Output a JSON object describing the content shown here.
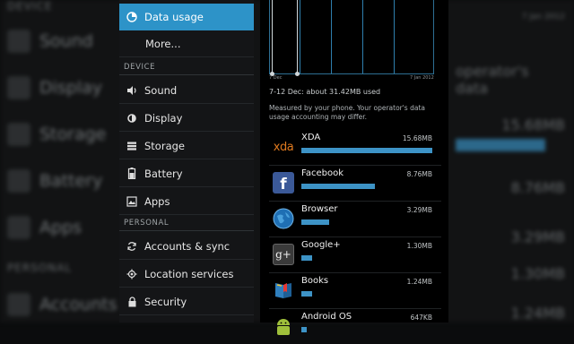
{
  "background": {
    "left_section_top": "DEVICE",
    "left_items": [
      "Sound",
      "Display",
      "Storage",
      "Battery",
      "Apps"
    ],
    "left_section_bottom": "PERSONAL",
    "left_last": "Accounts",
    "right_texts": [
      "7 Jan 2012",
      "operator's data",
      "15.68MB",
      "8.76MB",
      "3.29MB",
      "1.30MB",
      "1.24MB"
    ]
  },
  "settings": {
    "items_top": [
      {
        "label": "Data usage",
        "icon": "data-usage-icon",
        "active": true
      },
      {
        "label": "More...",
        "icon": "",
        "active": false
      }
    ],
    "section_device": "DEVICE",
    "items_device": [
      {
        "label": "Sound",
        "icon": "sound-icon"
      },
      {
        "label": "Display",
        "icon": "display-icon"
      },
      {
        "label": "Storage",
        "icon": "storage-icon"
      },
      {
        "label": "Battery",
        "icon": "battery-icon"
      },
      {
        "label": "Apps",
        "icon": "apps-icon"
      }
    ],
    "section_personal": "PERSONAL",
    "items_personal": [
      {
        "label": "Accounts & sync",
        "icon": "sync-icon"
      },
      {
        "label": "Location services",
        "icon": "location-icon"
      },
      {
        "label": "Security",
        "icon": "lock-icon"
      }
    ]
  },
  "detail": {
    "chart": {
      "start_label": "7 Dec",
      "end_label": "7 Jan 2012"
    },
    "range_summary": "7-12 Dec: about 31.42MB used",
    "note": "Measured by your phone. Your operator's data usage accounting may differ.",
    "apps": [
      {
        "name": "XDA",
        "size": "15.68MB",
        "fraction": 1.0,
        "icon": "xda-logo-icon",
        "color": "#e07a1f"
      },
      {
        "name": "Facebook",
        "size": "8.76MB",
        "fraction": 0.56,
        "icon": "facebook-icon",
        "color": "#3b5998"
      },
      {
        "name": "Browser",
        "size": "3.29MB",
        "fraction": 0.21,
        "icon": "globe-icon",
        "color": "#2a7bc0"
      },
      {
        "name": "Google+",
        "size": "1.30MB",
        "fraction": 0.083,
        "icon": "google-plus-icon",
        "color": "#444"
      },
      {
        "name": "Books",
        "size": "1.24MB",
        "fraction": 0.079,
        "icon": "books-icon",
        "color": "#2f7fbe"
      },
      {
        "name": "Android OS",
        "size": "647KB",
        "fraction": 0.04,
        "icon": "android-icon",
        "color": "#9fc03b"
      }
    ]
  }
}
